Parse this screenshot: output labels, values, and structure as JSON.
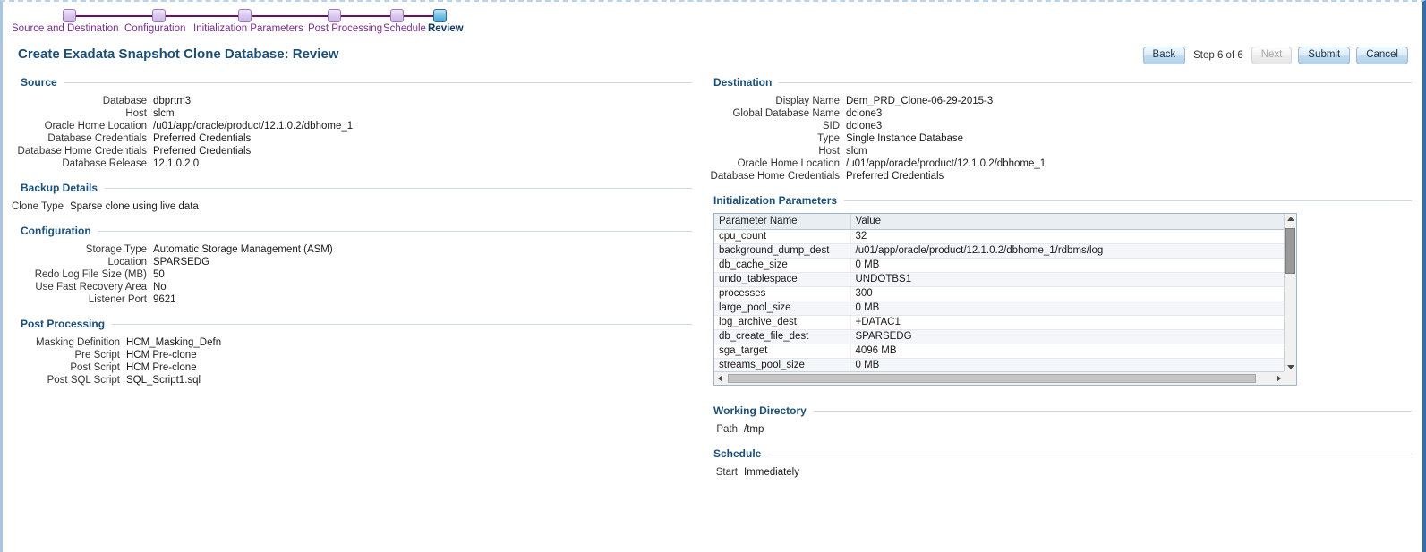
{
  "train": {
    "steps": [
      {
        "label": "Source and Destination",
        "active": false
      },
      {
        "label": "Configuration",
        "active": false
      },
      {
        "label": "Initialization Parameters",
        "active": false
      },
      {
        "label": "Post Processing",
        "active": false
      },
      {
        "label": "Schedule",
        "active": false
      },
      {
        "label": "Review",
        "active": true
      }
    ]
  },
  "header": {
    "title": "Create Exadata Snapshot Clone Database: Review",
    "back_label": "Back",
    "step_indicator": "Step 6 of 6",
    "next_label": "Next",
    "submit_label": "Submit",
    "cancel_label": "Cancel"
  },
  "source": {
    "heading": "Source",
    "rows": [
      {
        "label": "Database",
        "value": "dbprtm3"
      },
      {
        "label": "Host",
        "value": "slcm"
      },
      {
        "label": "Oracle Home Location",
        "value": "/u01/app/oracle/product/12.1.0.2/dbhome_1"
      },
      {
        "label": "Database Credentials",
        "value": "Preferred Credentials"
      },
      {
        "label": "Database Home Credentials",
        "value": "Preferred Credentials"
      },
      {
        "label": "Database Release",
        "value": "12.1.0.2.0"
      }
    ]
  },
  "backup_details": {
    "heading": "Backup Details",
    "rows": [
      {
        "label": "Clone Type",
        "value": "Sparse clone using live data"
      }
    ]
  },
  "configuration": {
    "heading": "Configuration",
    "rows": [
      {
        "label": "Storage Type",
        "value": "Automatic Storage Management (ASM)"
      },
      {
        "label": "Location",
        "value": "SPARSEDG"
      },
      {
        "label": "Redo Log File Size (MB)",
        "value": "50"
      },
      {
        "label": "Use Fast Recovery Area",
        "value": "No"
      },
      {
        "label": "Listener Port",
        "value": "9621"
      }
    ]
  },
  "post_processing": {
    "heading": "Post Processing",
    "rows": [
      {
        "label": "Masking Definition",
        "value": "HCM_Masking_Defn"
      },
      {
        "label": "Pre Script",
        "value": "HCM Pre-clone"
      },
      {
        "label": "Post Script",
        "value": "HCM Pre-clone"
      },
      {
        "label": "Post SQL Script",
        "value": "SQL_Script1.sql"
      }
    ]
  },
  "destination": {
    "heading": "Destination",
    "rows": [
      {
        "label": "Display Name",
        "value": "Dem_PRD_Clone-06-29-2015-3"
      },
      {
        "label": "Global Database Name",
        "value": "dclone3"
      },
      {
        "label": "SID",
        "value": "dclone3"
      },
      {
        "label": "Type",
        "value": "Single Instance Database"
      },
      {
        "label": "Host",
        "value": "slcm"
      },
      {
        "label": "Oracle Home Location",
        "value": "/u01/app/oracle/product/12.1.0.2/dbhome_1"
      },
      {
        "label": "Database Home Credentials",
        "value": "Preferred Credentials"
      }
    ]
  },
  "init_params": {
    "heading": "Initialization Parameters",
    "columns": [
      "Parameter Name",
      "Value"
    ],
    "rows": [
      [
        "cpu_count",
        "32"
      ],
      [
        "background_dump_dest",
        "/u01/app/oracle/product/12.1.0.2/dbhome_1/rdbms/log"
      ],
      [
        "db_cache_size",
        "0 MB"
      ],
      [
        "undo_tablespace",
        "UNDOTBS1"
      ],
      [
        "processes",
        "300"
      ],
      [
        "large_pool_size",
        "0 MB"
      ],
      [
        "log_archive_dest",
        "+DATAC1"
      ],
      [
        "db_create_file_dest",
        "SPARSEDG"
      ],
      [
        "sga_target",
        "4096 MB"
      ],
      [
        "streams_pool_size",
        "0 MB"
      ]
    ]
  },
  "working_directory": {
    "heading": "Working Directory",
    "rows": [
      {
        "label": "Path",
        "value": "/tmp"
      }
    ]
  },
  "schedule": {
    "heading": "Schedule",
    "rows": [
      {
        "label": "Start",
        "value": "Immediately"
      }
    ]
  }
}
